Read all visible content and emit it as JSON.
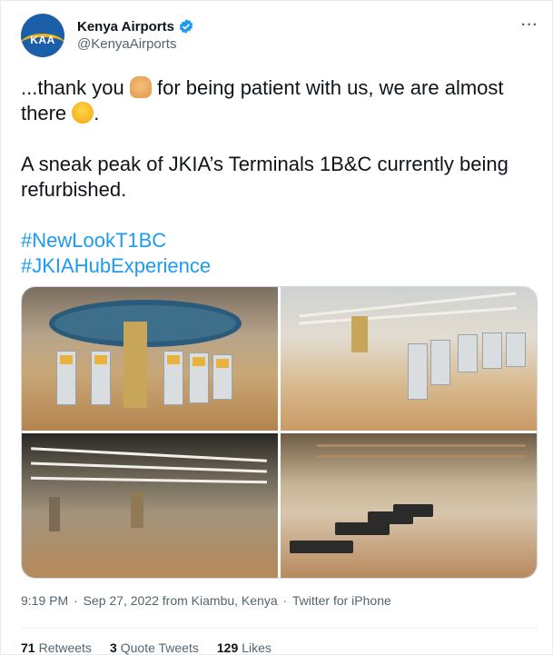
{
  "author": {
    "name": "Kenya Airports",
    "handle": "@KenyaAirports",
    "avatar_text": "KAA",
    "verified_color": "#1d9bf0"
  },
  "more_label": "···",
  "tweet": {
    "line1_a": "...thank you ",
    "line1_b": " for being patient with us, we are almost there ",
    "line1_c": ".",
    "line2": "A sneak peak of JKIA’s Terminals 1B&C currently being refurbished.",
    "hashtags": [
      "#NewLookT1BC",
      "#JKIAHubExperience"
    ],
    "emojis": [
      "folded-hands",
      "hugging-face"
    ]
  },
  "media": {
    "count": 4,
    "photos": [
      "check-in kiosks under circular ceiling",
      "terminal hall with kiosks",
      "departure hall with ceiling lights",
      "seating area with wooden slatted ceiling"
    ]
  },
  "meta": {
    "time": "9:19 PM",
    "date": "Sep 27, 2022",
    "location": "from Kiambu, Kenya",
    "client": "Twitter for iPhone"
  },
  "stats": {
    "retweets_count": "71",
    "retweets_label": "Retweets",
    "quotes_count": "3",
    "quotes_label": "Quote Tweets",
    "likes_count": "129",
    "likes_label": "Likes"
  },
  "colors": {
    "link": "#1d9bf0",
    "secondary_text": "#536471",
    "primary_text": "#0f1419"
  }
}
